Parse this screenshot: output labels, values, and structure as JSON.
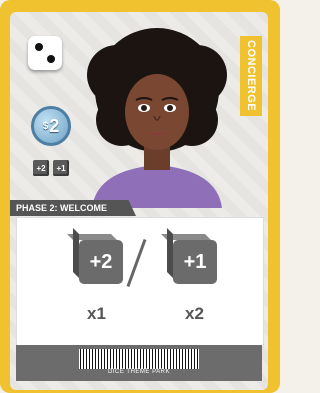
{
  "card": {
    "role": "CONCIERGE",
    "cost": "2",
    "cost_symbol": "$",
    "mini_bonuses": [
      "+2",
      "+1"
    ],
    "phase_label": "PHASE 2: WELCOME",
    "options": [
      {
        "die": "+2",
        "multiplier": "x1"
      },
      {
        "die": "+1",
        "multiplier": "x2"
      }
    ],
    "barcode_text": "DICE THEME PARK"
  },
  "colors": {
    "border": "#f0c230",
    "phase_banner": "#555555",
    "coin": "#6fa2c4",
    "die": "#6b6b6b"
  }
}
